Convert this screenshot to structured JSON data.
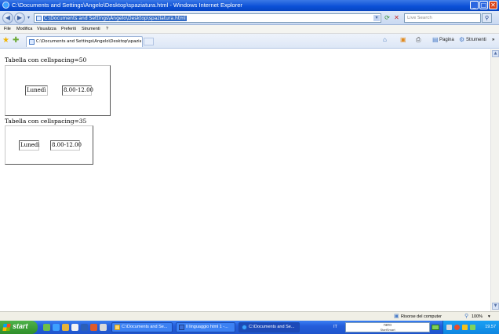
{
  "window": {
    "title": "C:\\Documents and Settings\\Angelo\\Desktop\\spaziatura.html - Windows Internet Explorer",
    "minimize_glyph": "_",
    "maximize_glyph": "□",
    "close_glyph": "✕"
  },
  "address_bar": {
    "url": "C:\\Documents and Settings\\Angelo\\Desktop\\spaziatura.html",
    "search_placeholder": "Live Search"
  },
  "menu": {
    "items": [
      "File",
      "Modifica",
      "Visualizza",
      "Preferiti",
      "Strumenti",
      "?"
    ]
  },
  "tabs": {
    "active_tab": "C:\\Documents and Settings\\Angelo\\Desktop\\spaziatur...",
    "commands": {
      "page": "Pagina",
      "tools": "Strumenti"
    }
  },
  "page": {
    "tables": [
      {
        "caption": "Tabella con cellspacing=50",
        "cells": [
          "Lunedì",
          "8.00-12.00"
        ]
      },
      {
        "caption": "Tabella con cellspacing=35",
        "cells": [
          "Lunedì",
          "8.00-12.00"
        ]
      }
    ]
  },
  "status_bar": {
    "zone": "Risorse del computer",
    "zoom": "100%"
  },
  "taskbar": {
    "start_label": "start",
    "tasks": [
      {
        "label": "C:\\Documents and Se...",
        "active": false
      },
      {
        "label": "Il linguaggio html 1 -...",
        "active": false
      },
      {
        "label": "C:\\Documents and Se...",
        "active": true
      }
    ],
    "language": "IT",
    "toolbar_text": "nero",
    "toolbar_subtext": "StartSmart",
    "clock": "19.57"
  },
  "colors": {
    "titlebar": "#0a4fd6",
    "taskbar": "#245edb",
    "start_button": "#3a9a35",
    "selection": "#316ac5"
  }
}
